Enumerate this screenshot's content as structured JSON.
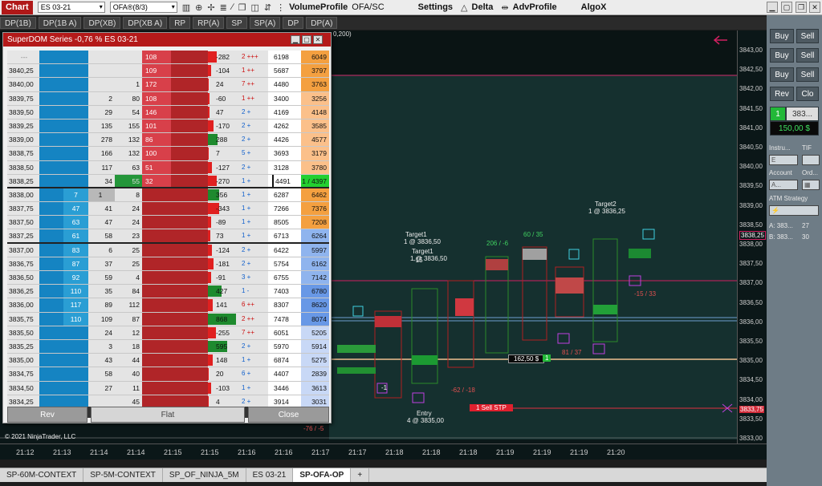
{
  "toolbar": {
    "chart_label": "Chart",
    "instrument": "ES 03-21",
    "bar_type": "OFA®(8/3)",
    "volume_profile": "VolumeProfile",
    "ofa_sc": "OFA/SC",
    "settings": "Settings",
    "delta": "Delta",
    "adv_profile": "AdvProfile",
    "algox": "AlgoX"
  },
  "study_tabs": [
    "DP(1B)",
    "DP(1B A)",
    "DP(XB)",
    "DP(XB A)",
    "RP",
    "RP(A)",
    "SP",
    "SP(A)",
    "DP",
    "DP(A)"
  ],
  "chart": {
    "top_label": "0,200)",
    "copyright": "© 2021 NinjaTrader, LLC",
    "price_ticks": [
      "3843,00",
      "3842,75",
      "3842,50",
      "3842,25",
      "3842,00",
      "3841,75",
      "3841,50",
      "3841,25",
      "3841,00",
      "3840,75",
      "3840,50",
      "3840,25",
      "3840,00",
      "3839,75",
      "3839,50",
      "3839,25",
      "3839,00",
      "3838,75",
      "3838,50",
      "3838,25",
      "3838,00",
      "3837,75",
      "3837,50",
      "3837,25",
      "3837,00",
      "3836,75",
      "3836,50",
      "3836,25",
      "3836,00",
      "3835,75",
      "3835,50",
      "3835,25",
      "3835,00",
      "3834,75",
      "3834,50",
      "3834,25",
      "3834,00",
      "3833,75",
      "3833,50",
      "3833,25",
      "3833,00"
    ],
    "highlight_price": "3838,25",
    "sell_price": "3833,75",
    "time_ticks": [
      "21:12",
      "21:13",
      "21:14",
      "21:14",
      "21:15",
      "21:15",
      "21:16",
      "21:16",
      "21:17",
      "21:17",
      "21:18",
      "21:18",
      "21:18",
      "21:19",
      "21:19",
      "21:19",
      "21:20"
    ],
    "labels": {
      "target1a": "Target1",
      "target1a_price": "1 @ 3836,50",
      "target1b": "Target1",
      "target1b_price": "1 @ 3836,50",
      "target2": "Target2",
      "target2_price": "1 @ 3836,25",
      "entry": "Entry",
      "entry_price": "4 @ 3835,00",
      "delta1": "206 / -6",
      "delta2": "60 / 35",
      "pl_box": "162,50 $",
      "pl_qty": "1",
      "sell_stp": "1  Sell STP",
      "d_left": "-76 / -5",
      "d_mid": "-62 / -18",
      "d_right": "-15 / 33",
      "d_right2": "81 / 37",
      "d_a": "-1",
      "d_b": "-15"
    }
  },
  "right_panel": {
    "buy": "Buy",
    "sell": "Sell",
    "rev": "Rev",
    "close": "Clo",
    "position_qty": "1",
    "position_price": "383...",
    "pnl": "150,00 $",
    "instrument_lbl": "Instru...",
    "tif_lbl": "TIF",
    "instrument_val": "E",
    "account_lbl": "Account",
    "order_lbl": "Ord...",
    "account_val": "A...",
    "atm_lbl": "ATM Strategy",
    "ask_line": "A:  383...",
    "ask_qty": "27",
    "bid_line": "B:  383...",
    "bid_qty": "30"
  },
  "bottom_tabs": [
    "SP-60M-CONTEXT",
    "SP-5M-CONTEXT",
    "SP_OF_NINJA_5M",
    "ES 03-21",
    "SP-OFA-OP",
    "SP-OFA-OP"
  ],
  "dom": {
    "title": "SuperDOM Series -0,76 % ES 03-21",
    "header_price": "---",
    "rows": [
      {
        "price": "",
        "bid": "",
        "v1": "",
        "v2": "",
        "ask": "108",
        "pl": "-282",
        "cnt": "2 +++",
        "t1": "6198",
        "t2": "6049"
      },
      {
        "price": "3840,25",
        "bid": "",
        "v1": "",
        "v2": "",
        "ask": "109",
        "pl": "-104",
        "cnt": "1 ++",
        "t1": "5687",
        "t2": "3797"
      },
      {
        "price": "3840,00",
        "bid": "",
        "v1": "",
        "v2": "1",
        "ask": "172",
        "pl": "24",
        "cnt": "7 ++",
        "t1": "4480",
        "t2": "3763"
      },
      {
        "price": "3839,75",
        "bid": "",
        "v1": "2",
        "v2": "80",
        "ask": "108",
        "pl": "-60",
        "cnt": "1 ++",
        "t1": "3400",
        "t2": "3256"
      },
      {
        "price": "3839,50",
        "bid": "",
        "v1": "29",
        "v2": "54",
        "ask": "146",
        "pl": "47",
        "cnt": "2 +",
        "t1": "4169",
        "t2": "4148"
      },
      {
        "price": "3839,25",
        "bid": "",
        "v1": "135",
        "v2": "155",
        "ask": "101",
        "pl": "-170",
        "cnt": "2 +",
        "t1": "4262",
        "t2": "3585"
      },
      {
        "price": "3839,00",
        "bid": "",
        "v1": "278",
        "v2": "132",
        "ask": "86",
        "pl": "288",
        "cnt": "2 +",
        "t1": "4426",
        "t2": "4577"
      },
      {
        "price": "3838,75",
        "bid": "",
        "v1": "166",
        "v2": "132",
        "ask": "100",
        "pl": "7",
        "cnt": "5 +",
        "t1": "3693",
        "t2": "3179"
      },
      {
        "price": "3838,50",
        "bid": "",
        "v1": "117",
        "v2": "63",
        "ask": "51",
        "pl": "-127",
        "cnt": "2 +",
        "t1": "3128",
        "t2": "3780"
      },
      {
        "price": "3838,25",
        "bid": "",
        "v1": "34",
        "v2": "55",
        "ask": "32",
        "pl": "-270",
        "cnt": "1 +",
        "t1": "4491",
        "t2": "1 / 4397"
      },
      {
        "price": "3838,00",
        "bid": "7",
        "v1": "1",
        "v2": "8",
        "ask": "",
        "pl": "356",
        "cnt": "1 +",
        "t1": "6287",
        "t2": "6462"
      },
      {
        "price": "3837,75",
        "bid": "47",
        "v1": "41",
        "v2": "24",
        "ask": "",
        "pl": "-343",
        "cnt": "1 +",
        "t1": "7266",
        "t2": "7376"
      },
      {
        "price": "3837,50",
        "bid": "63",
        "v1": "47",
        "v2": "24",
        "ask": "",
        "pl": "-89",
        "cnt": "1 +",
        "t1": "8505",
        "t2": "7208"
      },
      {
        "price": "3837,25",
        "bid": "61",
        "v1": "58",
        "v2": "23",
        "ask": "",
        "pl": "73",
        "cnt": "1 +",
        "t1": "6713",
        "t2": "6264"
      },
      {
        "price": "3837,00",
        "bid": "83",
        "v1": "6",
        "v2": "25",
        "ask": "",
        "pl": "-124",
        "cnt": "2 +",
        "t1": "6422",
        "t2": "5997"
      },
      {
        "price": "3836,75",
        "bid": "87",
        "v1": "37",
        "v2": "25",
        "ask": "",
        "pl": "-181",
        "cnt": "2 +",
        "t1": "5754",
        "t2": "6162"
      },
      {
        "price": "3836,50",
        "bid": "92",
        "v1": "59",
        "v2": "4",
        "ask": "",
        "pl": "-91",
        "cnt": "3 +",
        "t1": "6755",
        "t2": "7142"
      },
      {
        "price": "3836,25",
        "bid": "110",
        "v1": "35",
        "v2": "84",
        "ask": "",
        "pl": "427",
        "cnt": "1 -",
        "t1": "7403",
        "t2": "6780"
      },
      {
        "price": "3836,00",
        "bid": "117",
        "v1": "89",
        "v2": "112",
        "ask": "",
        "pl": "141",
        "cnt": "6 ++",
        "t1": "8307",
        "t2": "8620"
      },
      {
        "price": "3835,75",
        "bid": "110",
        "v1": "109",
        "v2": "87",
        "ask": "",
        "pl": "868",
        "cnt": "2 ++",
        "t1": "7478",
        "t2": "8074"
      },
      {
        "price": "3835,50",
        "bid": "",
        "v1": "24",
        "v2": "12",
        "ask": "",
        "pl": "-255",
        "cnt": "7 ++",
        "t1": "6051",
        "t2": "5205"
      },
      {
        "price": "3835,25",
        "bid": "",
        "v1": "3",
        "v2": "18",
        "ask": "",
        "pl": "595",
        "cnt": "2 +",
        "t1": "5970",
        "t2": "5914"
      },
      {
        "price": "3835,00",
        "bid": "",
        "v1": "43",
        "v2": "44",
        "ask": "",
        "pl": "148",
        "cnt": "1 +",
        "t1": "6874",
        "t2": "5275"
      },
      {
        "price": "3834,75",
        "bid": "",
        "v1": "58",
        "v2": "40",
        "ask": "",
        "pl": "20",
        "cnt": "6 +",
        "t1": "4407",
        "t2": "2839"
      },
      {
        "price": "3834,50",
        "bid": "",
        "v1": "27",
        "v2": "11",
        "ask": "",
        "pl": "-103",
        "cnt": "1 +",
        "t1": "3446",
        "t2": "3613"
      },
      {
        "price": "3834,25",
        "bid": "",
        "v1": "",
        "v2": "45",
        "ask": "",
        "pl": "4",
        "cnt": "2 +",
        "t1": "3914",
        "t2": "3031"
      }
    ],
    "rev": "Rev",
    "flat": "Flat",
    "close": "Close"
  }
}
